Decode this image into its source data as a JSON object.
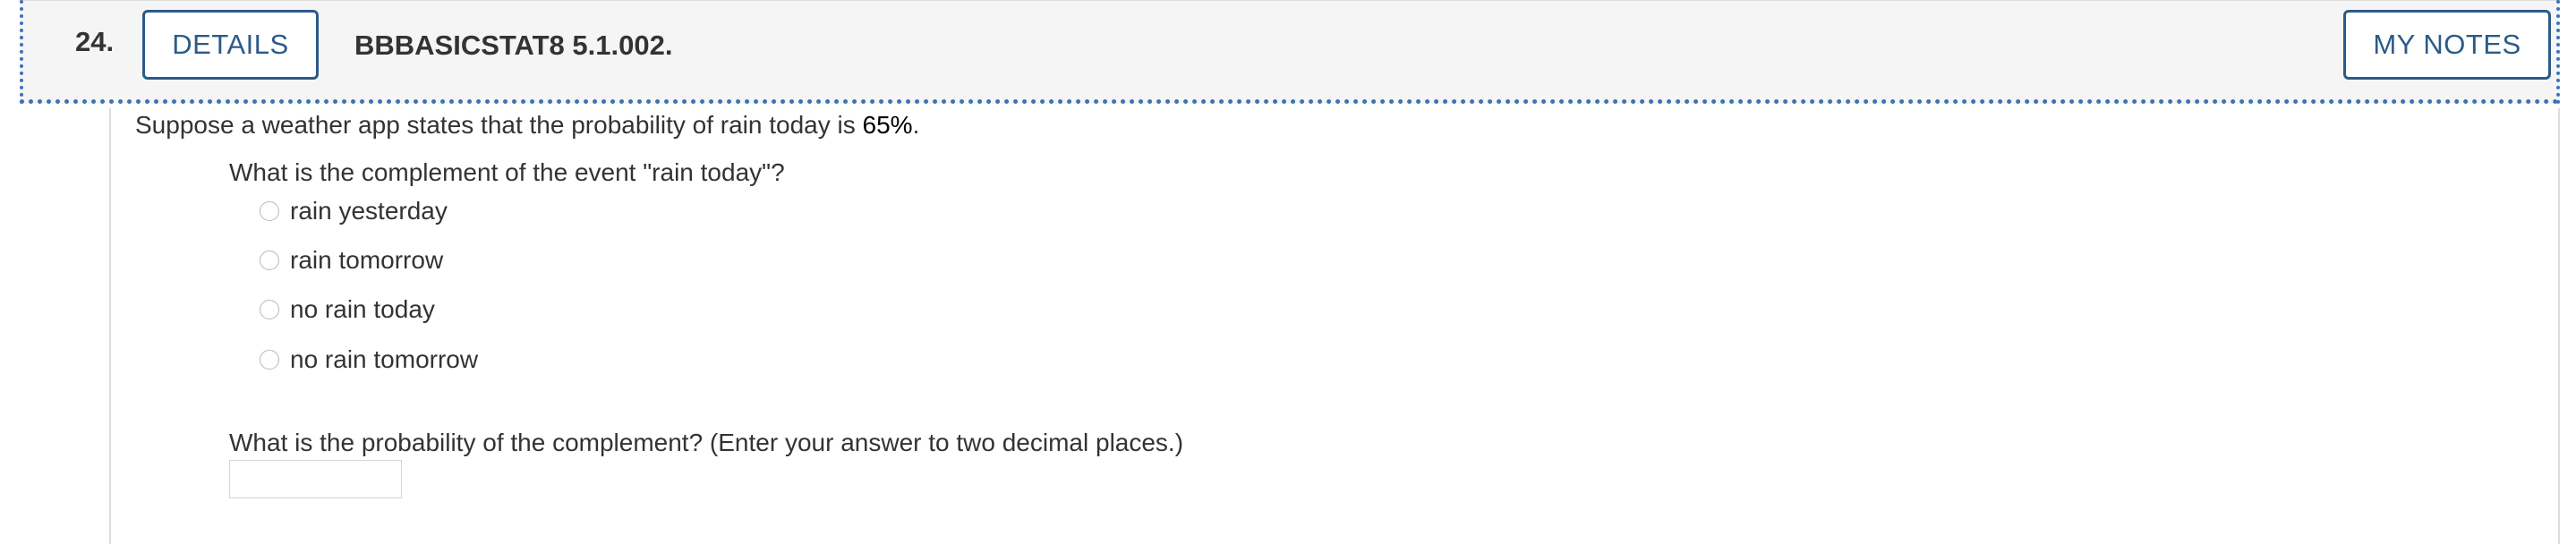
{
  "header": {
    "question_number": "24.",
    "details_label": "DETAILS",
    "question_code": "BBBASICSTAT8 5.1.002.",
    "notes_label": "MY NOTES"
  },
  "question": {
    "stem_before": "Suppose a weather app states that the probability of rain today is ",
    "stem_pct": "65%",
    "stem_after": ".",
    "part1": {
      "prompt": "What is the complement of the event \"rain today\"?",
      "options": [
        {
          "label": "rain yesterday",
          "selected": false
        },
        {
          "label": "rain tomorrow",
          "selected": false
        },
        {
          "label": "no rain today",
          "selected": false
        },
        {
          "label": "no rain tomorrow",
          "selected": false
        }
      ]
    },
    "part2": {
      "prompt": "What is the probability of the complement? (Enter your answer to two decimal places.)",
      "answer_value": ""
    }
  }
}
